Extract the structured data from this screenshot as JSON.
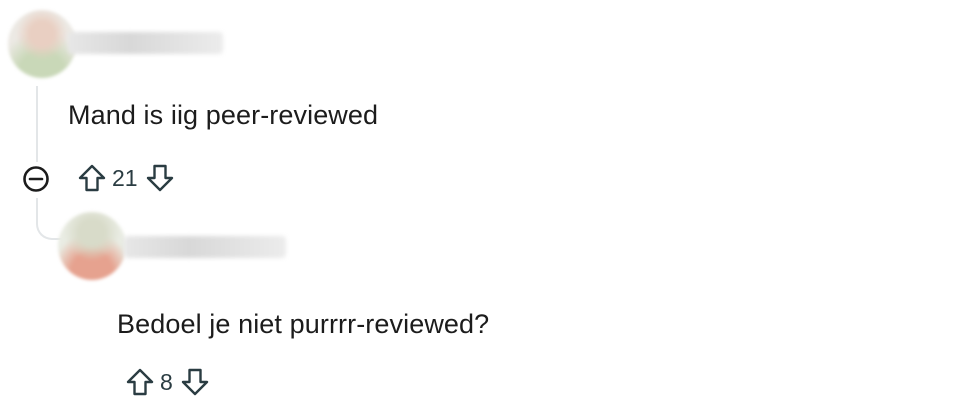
{
  "comments": [
    {
      "text": "Mand is iig peer-reviewed",
      "score": "21"
    },
    {
      "text": "Bedoel je niet purrrr-reviewed?",
      "score": "8"
    }
  ],
  "colors": {
    "text": "#1c1c1c",
    "icon": "#2a3c42",
    "thread_line": "#e3e6e8",
    "background": "#ffffff"
  },
  "icons": {
    "collapse": "minus-circle-icon",
    "upvote": "upvote-arrow-icon",
    "downvote": "downvote-arrow-icon"
  }
}
